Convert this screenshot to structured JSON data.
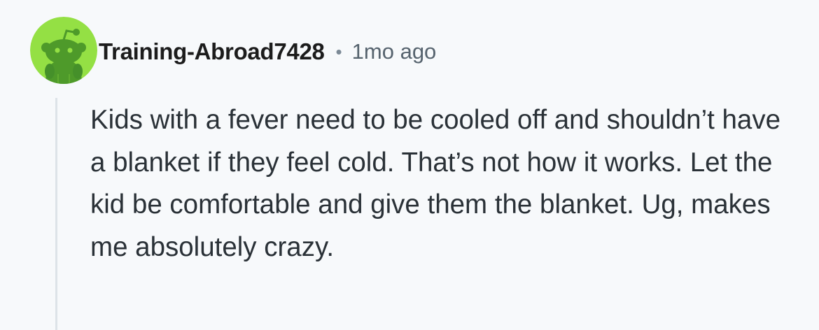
{
  "comment": {
    "username": "Training-Abroad7428",
    "separator": "•",
    "timestamp": "1mo ago",
    "text": "Kids with a fever need to be cooled off and shouldn’t have a blanket if they feel cold. That’s not how it works. Let the kid be comfortable and give them the blanket. Ug, makes me absolutely crazy."
  },
  "avatar": {
    "icon": "reddit-snoo-avatar-icon",
    "background_color": "#94e044",
    "figure_color": "#4e9a2a"
  },
  "colors": {
    "page_background": "#f7f9fb",
    "username": "#1c1c1c",
    "meta_text": "#56636e",
    "body_text": "#2a3137",
    "thread_line": "#dde3e8"
  }
}
